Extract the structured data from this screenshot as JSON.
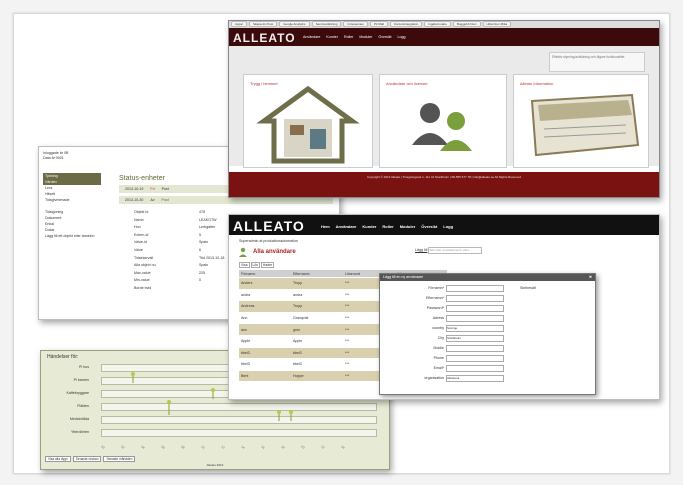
{
  "status_window": {
    "top_left_lines": [
      "Inloggade är 0B",
      "Data är 0001"
    ],
    "logo": "W",
    "sidebar": [
      "Tydning",
      "Värden",
      "Lera",
      "Hitsett",
      "Tidsgivrbenade",
      "",
      "Tidsigoning",
      "Dokument",
      "Enkal",
      "Dokar",
      "Lägg till ett objekt eller tamelon"
    ],
    "title": "Status-enheter",
    "date_rows": [
      {
        "date": "2013-10-19",
        "a": "Fri",
        "b": "Post"
      },
      {
        "date": "2013-10-30",
        "a": "Av",
        "b": "Post"
      }
    ],
    "fields": [
      "Objekt Id",
      "Namn",
      "Hon",
      "Extern-id",
      "Value-id",
      "Value",
      "Tidsintervall",
      "Alla object nu",
      "Max-value",
      "Min-value",
      "Borde bvid"
    ],
    "values": [
      "478",
      "LEAKGTW",
      "Lerbgatter",
      "5",
      "Spain",
      "6",
      "Ttid 2013-10-18",
      "Spain",
      "225",
      "0",
      ""
    ]
  },
  "home_window": {
    "browser_tabs": [
      "Appar",
      "Skapa din Post",
      "Google Analytics",
      "Sammanfattning",
      "Intressenten",
      "P2 Mall",
      "Kontorsintegration",
      "Ingaformulare",
      "Boggjobb hisni",
      "Hitta Dom Mitta"
    ],
    "logo": "ALLEATO",
    "menu": [
      "Användare",
      "Kunder",
      "Roller",
      "Moduler",
      "Översikt",
      "Logg"
    ],
    "notice": "Effektiv styrning/avbildning och tågare funktionalitet",
    "cards": [
      "Trygg i hemmet",
      "Användare och licenser",
      "Alleato Information"
    ],
    "footer": "Copyright © 2013 Alleato | Tinsgwingsvia 1, 111 41 Stockholm | 08-555 677 78 | info@alleato.se All Rights Reserved"
  },
  "users_window": {
    "logo": "ALLEATO",
    "menu": [
      "Hem",
      "Användare",
      "Kunder",
      "Roller",
      "Moduler",
      "Översikt",
      "Logg"
    ],
    "breadcrumb": "Superadmin at productionautomation",
    "page_title": "Alla användare",
    "add_link": "Lägg till",
    "search_placeholder": "Sök efter användarnamn eller...",
    "filter_tabs": [
      "Visa",
      "Lös",
      "Hader"
    ],
    "columns": [
      "Förnamn",
      "Efternamn",
      "Lösenord",
      "Adress"
    ],
    "rows": [
      [
        "Anders",
        "Tropp",
        "***",
        "Möbar-vägen"
      ],
      [
        "andra",
        "andra",
        "***",
        "Möbar-vägen"
      ],
      [
        "Andreas",
        "Tropp",
        "***",
        "Möbar-vägen"
      ],
      [
        "Ann",
        "Granqvist",
        "***",
        "gata"
      ],
      [
        "ann",
        "gren",
        "***",
        "Möbar-vägen"
      ],
      [
        "Apple",
        "Apple",
        "***",
        "adress"
      ],
      [
        "bbel3",
        "bbel3",
        "***",
        "Möbar-vägen"
      ],
      [
        "bbel3",
        "bbel3",
        "***",
        "Möbar-vägen"
      ],
      [
        "Bent",
        "Hoppe",
        "***",
        "Möbar-vägen"
      ]
    ],
    "modal_title": "Lägg till en ny användare",
    "modal_fields": [
      "Förnamn*",
      "Efternamn*",
      "Password*",
      "Adress",
      "country",
      "City",
      "Mobile",
      "Phone",
      "Email*",
      "organisation"
    ],
    "modal_dropdowns": {
      "country": "Sverige",
      "City": "Stockholm",
      "organisation": "Alleatoca"
    },
    "modal_side": "Skribesält"
  },
  "timeline_window": {
    "title": "Händelser för:",
    "rows": [
      "Pi hus",
      "Pi barnen",
      "Kaffebryggare",
      "Fläkten",
      "Medicinlåda",
      "Ytterdörren"
    ],
    "buttons": [
      "Visa alla dygn",
      "Senaste veckan",
      "Senaste månaden"
    ],
    "footer": "Alleato 2013"
  },
  "colors": {
    "olive": "#6b6b45",
    "maroon": "#7a1212",
    "dark": "#111111"
  }
}
